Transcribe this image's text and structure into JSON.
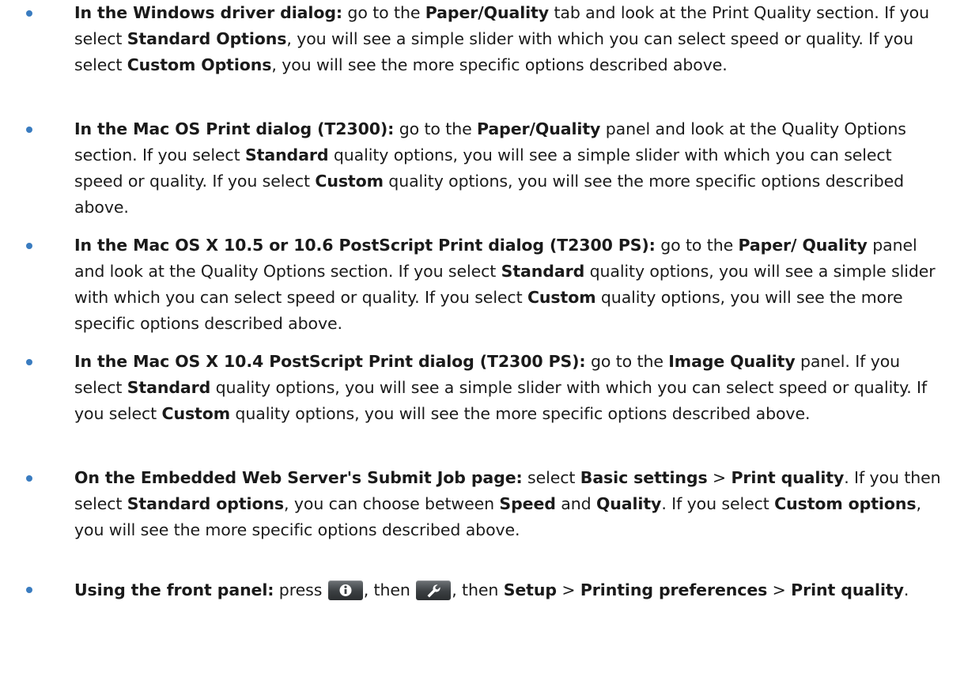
{
  "items": [
    {
      "lead": "In the Windows driver dialog:",
      "t1": " go to the ",
      "b1": "Paper/Quality",
      "t2": " tab and look at the Print Quality section. If you select ",
      "b2": "Standard Options",
      "t3": ", you will see a simple slider with which you can select speed or quality. If you select ",
      "b3": "Custom Options",
      "t4": ", you will see the more specific options described above."
    },
    {
      "lead": "In the Mac OS Print dialog (T2300):",
      "t1": " go to the ",
      "b1": "Paper/Quality",
      "t2": " panel and look at the Quality Options section. If you select ",
      "b2": "Standard",
      "t3": " quality options, you will see a simple slider with which you can select speed or quality. If you select ",
      "b3": "Custom",
      "t4": " quality options, you will see the more specific options described above."
    },
    {
      "lead": "In the Mac OS X 10.5 or 10.6 PostScript Print dialog (T2300 PS):",
      "t1": " go to the ",
      "b1": "Paper/ Quality",
      "t2": " panel and look at the Quality Options section. If you select ",
      "b2": "Standard",
      "t3": " quality options, you will see a simple slider with which you can select speed or quality. If you select ",
      "b3": "Custom",
      "t4": " quality options, you will see the more specific options described above."
    },
    {
      "lead": "In the Mac OS X 10.4 PostScript Print dialog (T2300 PS):",
      "t1": " go to the ",
      "b1": "Image Quality",
      "t2": " panel. If you select ",
      "b2": "Standard",
      "t3": " quality options, you will see a simple slider with which you can select speed or quality. If you select ",
      "b3": "Custom",
      "t4": " quality options, you will see the more specific options described above."
    },
    {
      "lead": "On the Embedded Web Server's Submit Job page:",
      "t1": " select ",
      "b1": "Basic settings",
      "t2": " > ",
      "b2": "Print quality",
      "t3": ". If you then select ",
      "b3": "Standard options",
      "t4": ", you can choose between ",
      "b4": "Speed",
      "t5": " and ",
      "b5": "Quality",
      "t6": ". If you select ",
      "b6": "Custom options",
      "t7": ", you will see the more specific options described above."
    },
    {
      "lead": "Using the front panel:",
      "t1": " press ",
      "icon1": "info-icon",
      "t2": ", then ",
      "icon2": "wrench-icon",
      "t3": ", then ",
      "b1": "Setup",
      "t4": " > ",
      "b2": "Printing preferences",
      "t5": " > ",
      "b3": "Print quality",
      "t6": "."
    }
  ],
  "colors": {
    "bullet": "#3a7cc0",
    "text": "#1a1a1a",
    "icon_button": "#3b3f42"
  }
}
